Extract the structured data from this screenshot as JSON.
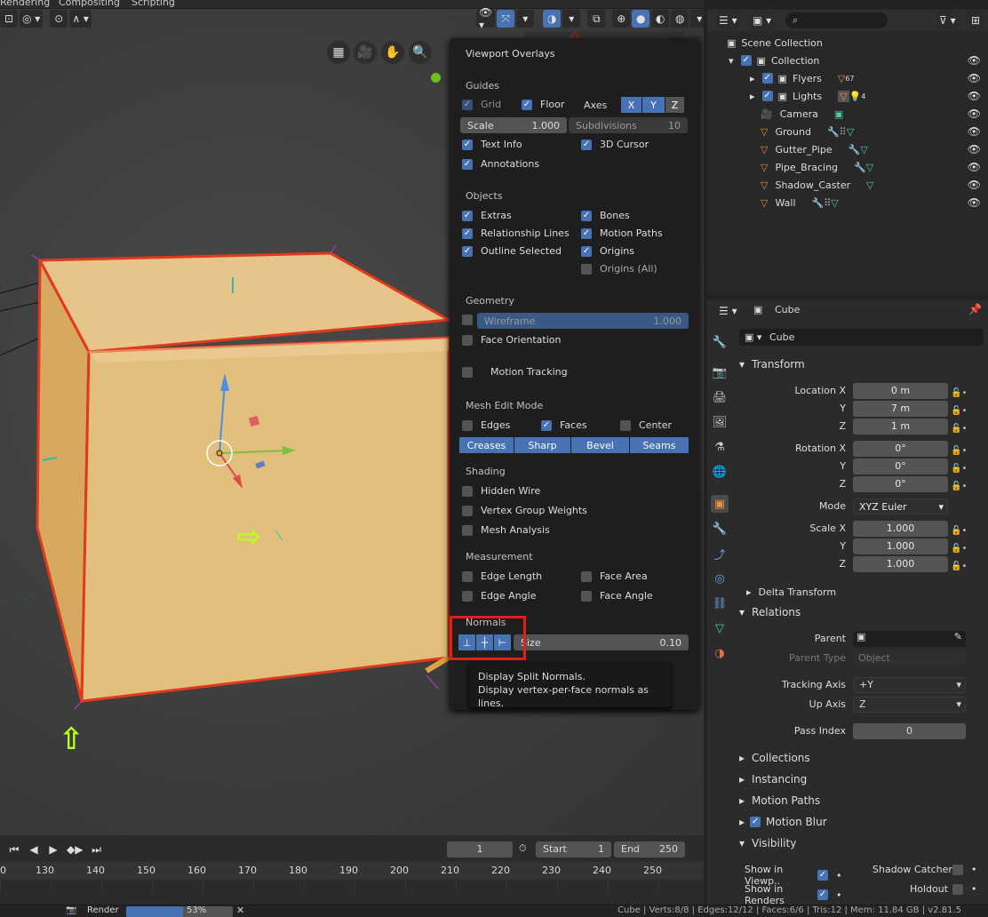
{
  "topbar": {
    "tab_rendering": "Rendering",
    "tab_compositing": "Compositing",
    "tab_scripting": "Scripting"
  },
  "overlays": {
    "title": "Viewport Overlays",
    "guides": {
      "heading": "Guides",
      "grid": "Grid",
      "floor": "Floor",
      "axes": "Axes",
      "x": "X",
      "y": "Y",
      "z": "Z",
      "scale_label": "Scale",
      "scale_value": "1.000",
      "subdiv_label": "Subdivisions",
      "subdiv_value": "10",
      "text_info": "Text Info",
      "cursor": "3D Cursor",
      "annotations": "Annotations"
    },
    "objects": {
      "heading": "Objects",
      "extras": "Extras",
      "bones": "Bones",
      "relationship": "Relationship Lines",
      "motion_paths": "Motion Paths",
      "outline": "Outline Selected",
      "origins": "Origins",
      "origins_all": "Origins (All)"
    },
    "geometry": {
      "heading": "Geometry",
      "wireframe": "Wireframe",
      "wire_value": "1.000",
      "face_orient": "Face Orientation",
      "motion_tracking": "Motion Tracking"
    },
    "mesh_edit": {
      "heading": "Mesh Edit Mode",
      "edges": "Edges",
      "faces": "Faces",
      "center": "Center",
      "creases": "Creases",
      "sharp": "Sharp",
      "bevel": "Bevel",
      "seams": "Seams"
    },
    "shading": {
      "heading": "Shading",
      "hidden_wire": "Hidden Wire",
      "vgroup": "Vertex Group Weights",
      "mesh_analysis": "Mesh Analysis"
    },
    "measurement": {
      "heading": "Measurement",
      "edge_length": "Edge Length",
      "face_area": "Face Area",
      "edge_angle": "Edge Angle",
      "face_angle": "Face Angle"
    },
    "normals": {
      "heading": "Normals",
      "size_label": "Size",
      "size_value": "0.10"
    },
    "tooltip": {
      "line1": "Display Split Normals.",
      "line2": "Display vertex-per-face normals as lines."
    }
  },
  "outliner": {
    "scene_collection": "Scene Collection",
    "items": [
      {
        "name": "Collection"
      },
      {
        "name": "Flyers",
        "badge": "67"
      },
      {
        "name": "Lights",
        "badge": "4"
      },
      {
        "name": "Camera"
      },
      {
        "name": "Ground"
      },
      {
        "name": "Gutter_Pipe"
      },
      {
        "name": "Pipe_Bracing"
      },
      {
        "name": "Shadow_Caster"
      },
      {
        "name": "Wall"
      }
    ]
  },
  "properties": {
    "object_name": "Cube",
    "data_name": "Cube",
    "transform": {
      "heading": "Transform",
      "loc_x_label": "Location X",
      "y_label": "Y",
      "z_label": "Z",
      "loc_x": "0 m",
      "loc_y": "7 m",
      "loc_z": "1 m",
      "rot_x_label": "Rotation X",
      "rot_x": "0°",
      "rot_y": "0°",
      "rot_z": "0°",
      "mode_label": "Mode",
      "mode": "XYZ Euler",
      "scale_x_label": "Scale X",
      "scale_x": "1.000",
      "scale_y": "1.000",
      "scale_z": "1.000",
      "delta": "Delta Transform"
    },
    "relations": {
      "heading": "Relations",
      "parent": "Parent",
      "parent_type": "Parent Type",
      "parent_type_val": "Object",
      "tracking_axis": "Tracking Axis",
      "tracking_val": "+Y",
      "up_axis": "Up Axis",
      "up_val": "Z",
      "pass_index": "Pass Index",
      "pass_val": "0"
    },
    "collections": "Collections",
    "instancing": "Instancing",
    "motion_paths": "Motion Paths",
    "motion_blur": "Motion Blur",
    "visibility": {
      "heading": "Visibility",
      "show_viewport": "Show in Viewp..",
      "shadow_catcher": "Shadow Catcher",
      "show_renders": "Show in Renders",
      "holdout": "Holdout"
    }
  },
  "timeline": {
    "frame": "1",
    "start_label": "Start",
    "start": "1",
    "end_label": "End",
    "end": "250",
    "ticks": [
      "0",
      "130",
      "140",
      "150",
      "160",
      "170",
      "180",
      "190",
      "200",
      "210",
      "220",
      "230",
      "240",
      "250"
    ]
  },
  "status": {
    "render": "Render",
    "progress": "53%",
    "stats": "Cube | Verts:8/8 | Edges:12/12 | Faces:6/6 | Tris:12 | Mem: 11.84 GB | v2.81.5"
  },
  "colors": {
    "accent": "#4772b3",
    "selected_outline": "#e03a1c",
    "cube": "#e3bf7d",
    "annotation_red": "#e0201a",
    "annotation_green": "#b8ff1f"
  }
}
